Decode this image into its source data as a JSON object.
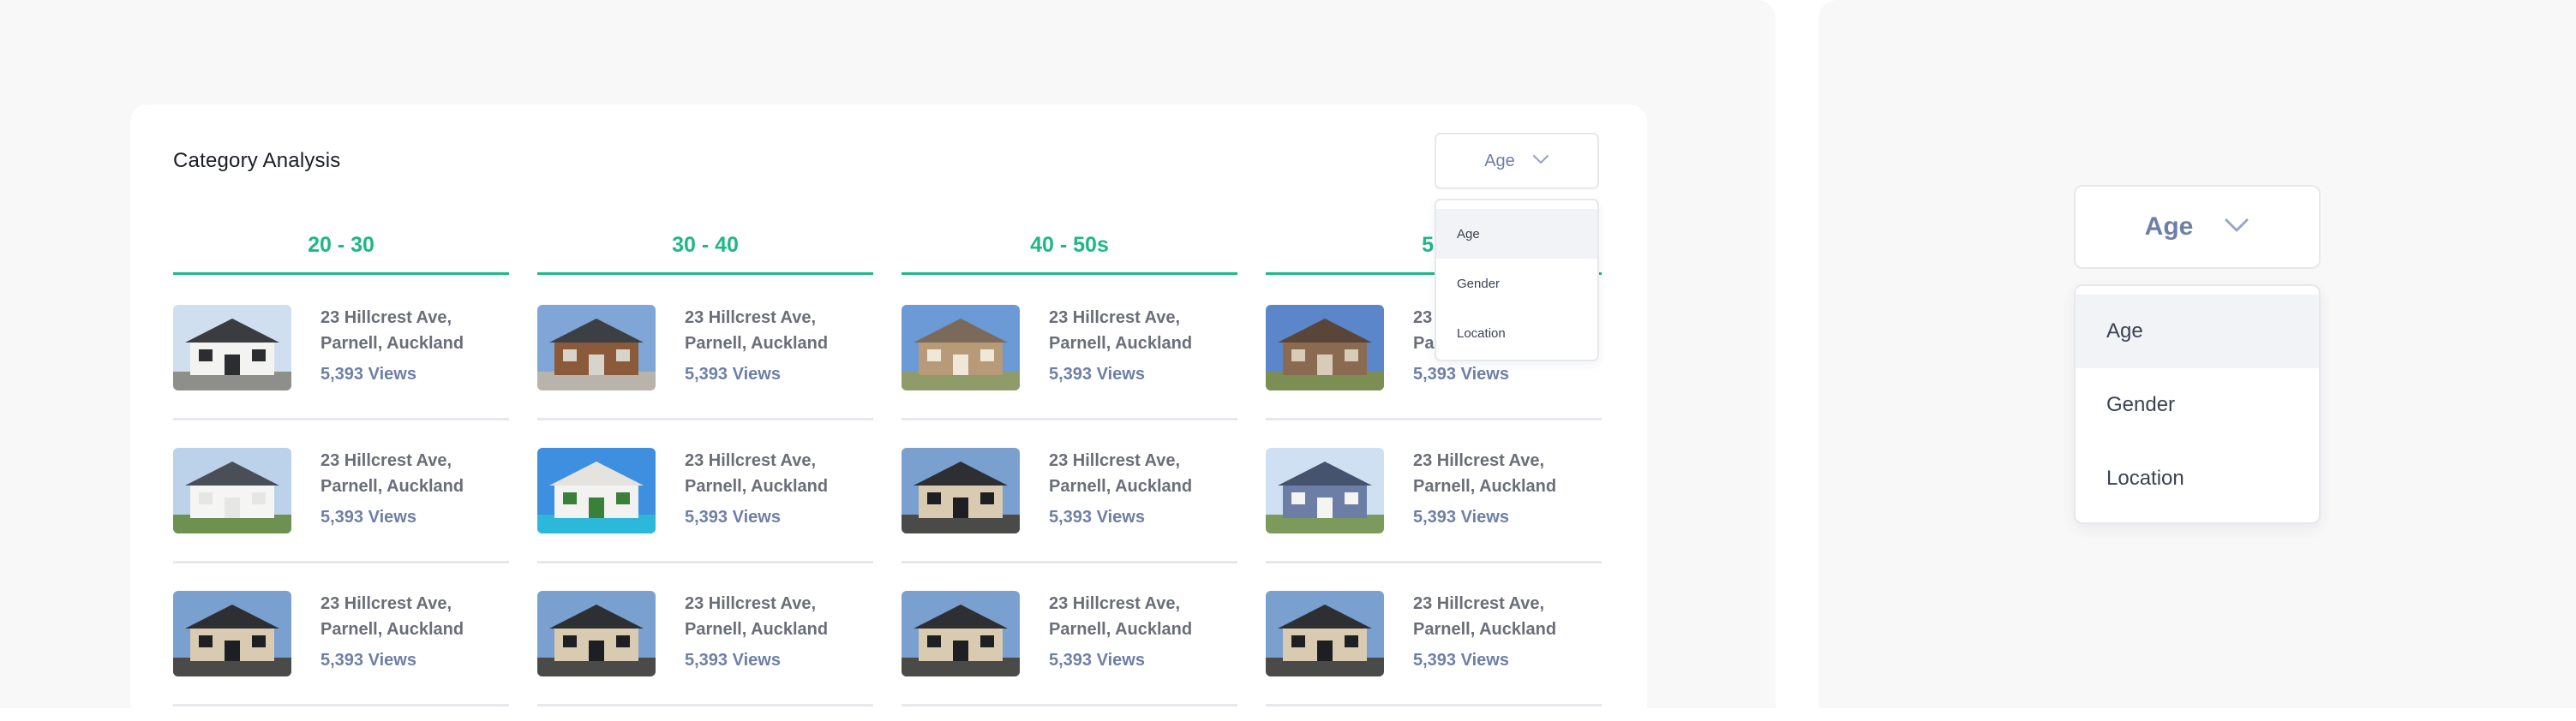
{
  "card": {
    "title": "Category Analysis"
  },
  "dropdown": {
    "selected": "Age",
    "options": [
      "Age",
      "Gender",
      "Location"
    ]
  },
  "columns": [
    {
      "label": "20 - 30"
    },
    {
      "label": "30 - 40"
    },
    {
      "label": "40 - 50s"
    },
    {
      "label": "50"
    }
  ],
  "listing": {
    "address_line1": "23 Hillcrest Ave,",
    "address_line2": "Parnell, Auckland",
    "views": "5,393 Views"
  },
  "preview": {
    "selected": "Age",
    "options": [
      "Age",
      "Gender",
      "Location"
    ]
  },
  "colors": {
    "accent_green": "#1eb884",
    "views_blue": "#6e7fa7",
    "panel_bg": "#f8f8f8"
  }
}
